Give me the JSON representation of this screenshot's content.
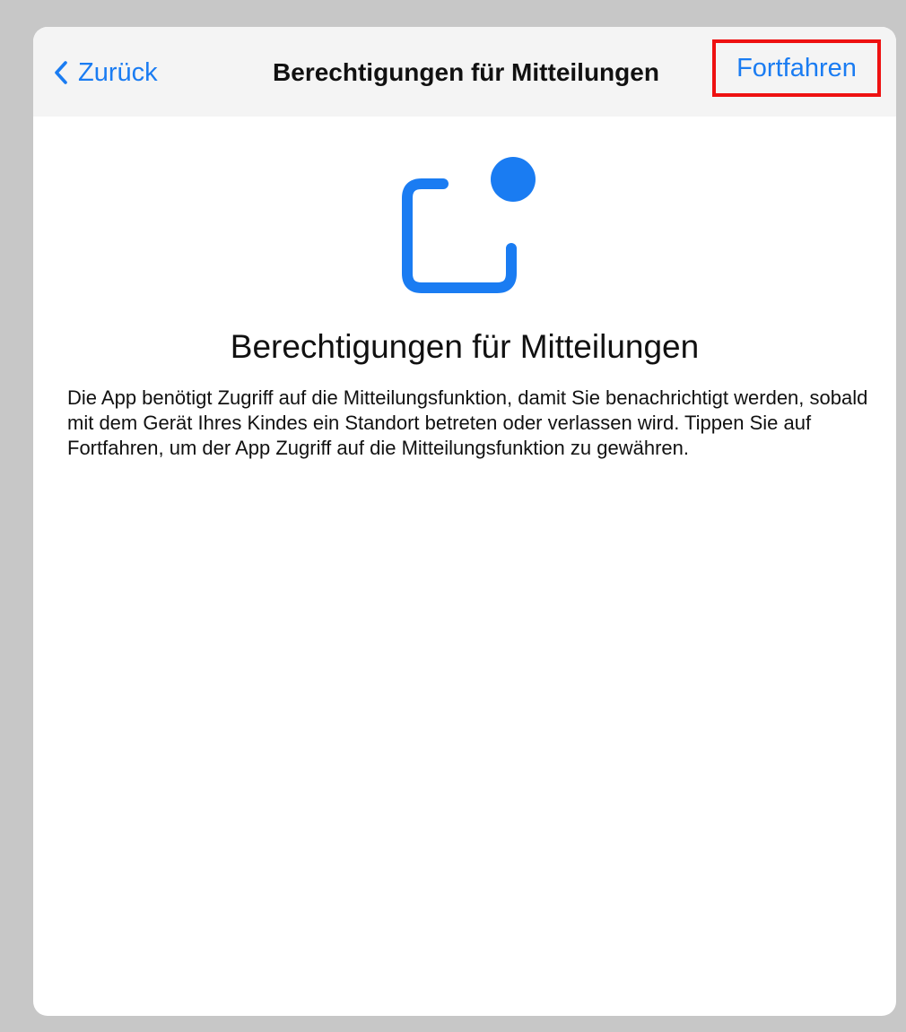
{
  "nav": {
    "back_label": "Zurück",
    "title": "Berechtigungen für Mitteilungen",
    "continue_label": "Fortfahren"
  },
  "content": {
    "icon": "notification-badge-icon",
    "heading": "Berechtigungen für Mitteilungen",
    "description": "Die App benötigt Zugriff auf die Mitteilungsfunktion, damit Sie benachrichtigt werden, sobald mit dem Gerät Ihres Kindes ein Standort betreten oder verlassen wird. Tippen Sie auf Fortfahren, um der App Zugriff auf die Mitteilungsfunktion zu gewähren."
  },
  "colors": {
    "accent": "#1a7cf2",
    "highlight_border": "#ee1111",
    "nav_background": "#f4f4f4",
    "backdrop": "#c7c7c7"
  }
}
